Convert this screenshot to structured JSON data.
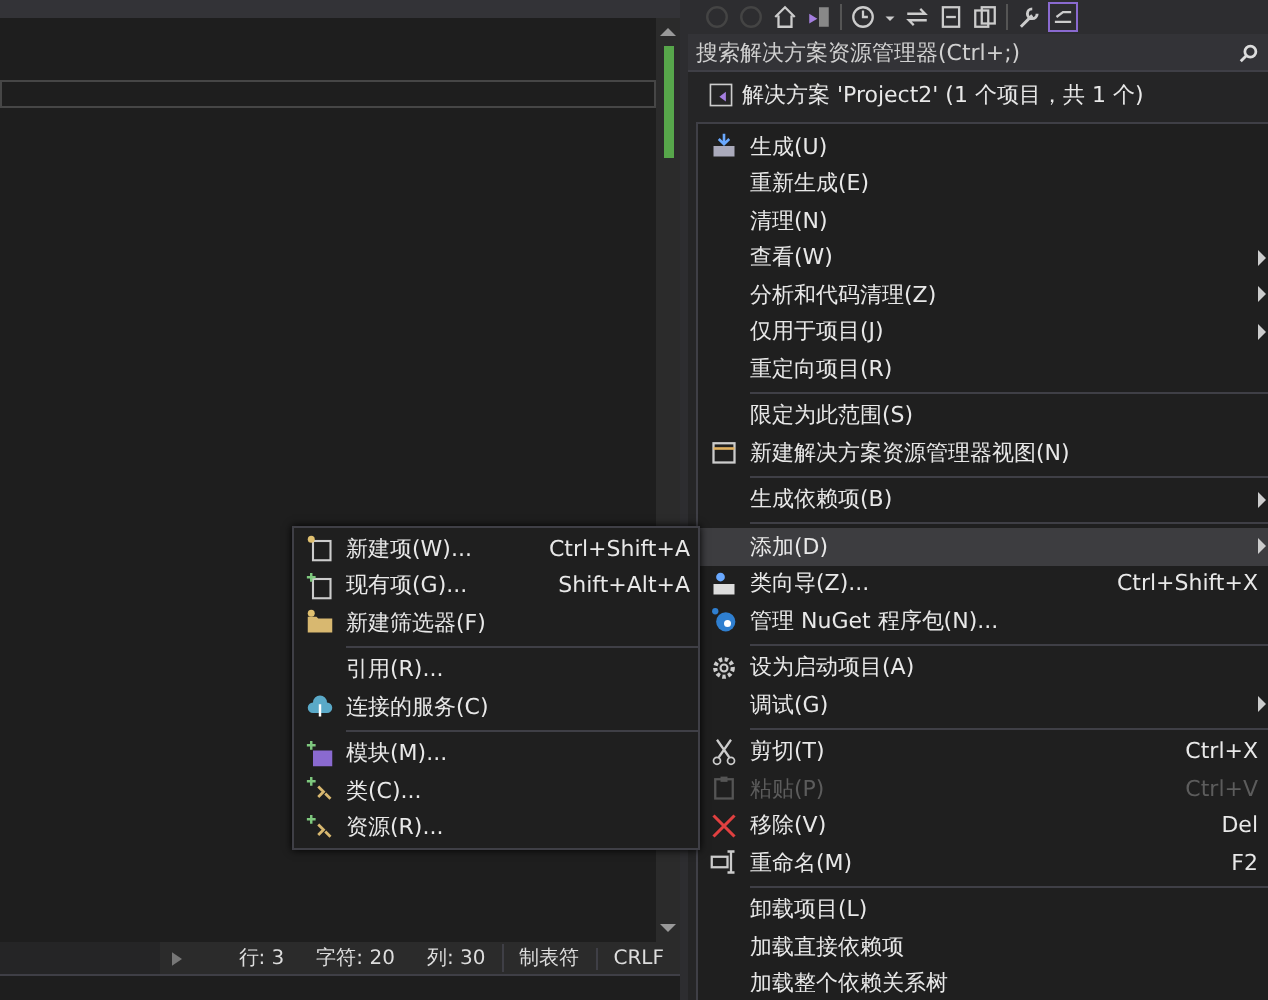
{
  "editor": {
    "status_bar": {
      "items": [
        "行: 3",
        "字符: 20",
        "列: 30",
        "制表符",
        "CRLF"
      ]
    }
  },
  "solution_explorer": {
    "search": {
      "placeholder": "搜索解决方案资源管理器(Ctrl+;)"
    },
    "tree": [
      {
        "label": "解决方案 'Project2' (1 个项目，共 1 个)"
      }
    ]
  },
  "context_menu": {
    "items": [
      {
        "kind": "item",
        "label": "生成(U)",
        "selected": false,
        "disabled": false,
        "submenu": false
      },
      {
        "kind": "item",
        "label": "重新生成(E)",
        "selected": false,
        "disabled": false,
        "submenu": false
      },
      {
        "kind": "item",
        "label": "清理(N)",
        "selected": false,
        "disabled": false,
        "submenu": false
      },
      {
        "kind": "item",
        "label": "查看(W)",
        "selected": false,
        "disabled": false,
        "submenu": true
      },
      {
        "kind": "item",
        "label": "分析和代码清理(Z)",
        "selected": false,
        "disabled": false,
        "submenu": true
      },
      {
        "kind": "item",
        "label": "仅用于项目(J)",
        "selected": false,
        "disabled": false,
        "submenu": true
      },
      {
        "kind": "item",
        "label": "重定向项目(R)",
        "selected": false,
        "disabled": false,
        "submenu": false
      },
      {
        "kind": "separator"
      },
      {
        "kind": "item",
        "label": "限定为此范围(S)",
        "selected": false,
        "disabled": false,
        "submenu": false
      },
      {
        "kind": "item",
        "label": "新建解决方案资源管理器视图(N)",
        "selected": false,
        "disabled": false,
        "submenu": false
      },
      {
        "kind": "separator"
      },
      {
        "kind": "item",
        "label": "生成依赖项(B)",
        "selected": false,
        "disabled": false,
        "submenu": true
      },
      {
        "kind": "separator"
      },
      {
        "kind": "item",
        "label": "添加(D)",
        "selected": true,
        "disabled": false,
        "submenu": true
      },
      {
        "kind": "item",
        "label": "类向导(Z)...",
        "shortcut": "Ctrl+Shift+X",
        "selected": false,
        "disabled": false,
        "submenu": false
      },
      {
        "kind": "item",
        "label": "管理 NuGet 程序包(N)...",
        "selected": false,
        "disabled": false,
        "submenu": false
      },
      {
        "kind": "separator"
      },
      {
        "kind": "item",
        "label": "设为启动项目(A)",
        "selected": false,
        "disabled": false,
        "submenu": false
      },
      {
        "kind": "item",
        "label": "调试(G)",
        "selected": false,
        "disabled": false,
        "submenu": true
      },
      {
        "kind": "separator"
      },
      {
        "kind": "item",
        "label": "剪切(T)",
        "shortcut": "Ctrl+X",
        "selected": false,
        "disabled": false,
        "submenu": false
      },
      {
        "kind": "item",
        "label": "粘贴(P)",
        "shortcut": "Ctrl+V",
        "selected": false,
        "disabled": true,
        "submenu": false
      },
      {
        "kind": "item",
        "label": "移除(V)",
        "shortcut": "Del",
        "selected": false,
        "disabled": false,
        "submenu": false
      },
      {
        "kind": "item",
        "label": "重命名(M)",
        "shortcut": "F2",
        "selected": false,
        "disabled": false,
        "submenu": false
      },
      {
        "kind": "separator"
      },
      {
        "kind": "item",
        "label": "卸载项目(L)",
        "selected": false,
        "disabled": false,
        "submenu": false
      },
      {
        "kind": "item",
        "label": "加载直接依赖项",
        "selected": false,
        "disabled": false,
        "submenu": false
      },
      {
        "kind": "item",
        "label": "加载整个依赖关系树",
        "selected": false,
        "disabled": false,
        "submenu": false
      }
    ]
  },
  "submenu": {
    "items": [
      {
        "kind": "item",
        "label": "新建项(W)...",
        "shortcut": "Ctrl+Shift+A",
        "selected": false
      },
      {
        "kind": "item",
        "label": "现有项(G)...",
        "shortcut": "Shift+Alt+A",
        "selected": false
      },
      {
        "kind": "item",
        "label": "新建筛选器(F)",
        "selected": false
      },
      {
        "kind": "separator"
      },
      {
        "kind": "item",
        "label": "引用(R)...",
        "selected": false
      },
      {
        "kind": "item",
        "label": "连接的服务(C)",
        "selected": false
      },
      {
        "kind": "separator"
      },
      {
        "kind": "item",
        "label": "模块(M)...",
        "selected": false
      },
      {
        "kind": "item",
        "label": "类(C)...",
        "selected": false
      },
      {
        "kind": "item",
        "label": "资源(R)...",
        "selected": false
      }
    ]
  }
}
